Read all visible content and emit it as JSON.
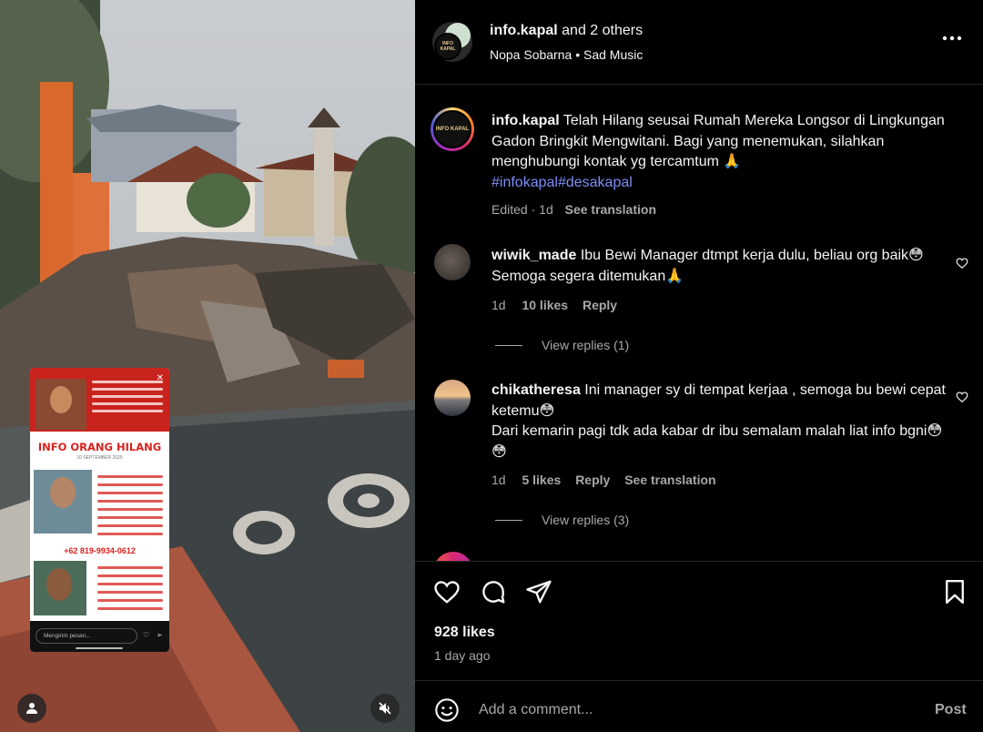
{
  "header": {
    "username": "info.kapal",
    "collab_text": "and 2 others",
    "sub_author": "Nopa Sobarna",
    "separator": "•",
    "sub_audio": "Sad Music",
    "avatar_text": "INFO KAPAL"
  },
  "caption": {
    "username": "info.kapal",
    "text": "Telah Hilang seusai Rumah Mereka Longsor di Lingkungan Gadon Bringkit Mengwitani. Bagi yang menemukan, silahkan menghubungi kontak yg tercamtum 🙏",
    "hashtags": "#infokapal#desakapal",
    "edited": "Edited",
    "dot": "·",
    "age": "1d",
    "see_translation": "See translation"
  },
  "comments": [
    {
      "username": "wiwik_made",
      "text": "Ibu Bewi Manager dtmpt kerja dulu, beliau org baik😳 Semoga segera ditemukan🙏",
      "age": "1d",
      "likes": "10 likes",
      "reply": "Reply",
      "view_replies": "View replies (1)"
    },
    {
      "username": "chikatheresa",
      "text": "Ini manager sy di tempat kerjaa , semoga bu bewi cepat ketemu😳",
      "text2": "Dari kemarin pagi tdk ada kabar dr ibu semalam malah liat info bgni😳 😳",
      "age": "1d",
      "likes": "5 likes",
      "reply": "Reply",
      "see_translation": "See translation",
      "view_replies": "View replies (3)"
    }
  ],
  "post": {
    "likes": "928 likes",
    "time": "1 day ago"
  },
  "add_comment": {
    "placeholder": "Add a comment...",
    "post_label": "Post"
  },
  "story": {
    "headline": "INFO ORANG HILANG",
    "date": "10 SEPTEMBER 2025",
    "phone": "+62 819-9934-0612",
    "message_placeholder": "Mengirim pesan..."
  },
  "colors": {
    "background": "#000000",
    "secondary_text": "#a8a8a8",
    "hashtag": "#7b8ef6",
    "story_red": "#d8231d"
  },
  "icons": [
    "heart-icon",
    "comment-icon",
    "share-icon",
    "bookmark-icon",
    "more-icon",
    "emoji-icon",
    "user-icon",
    "mute-icon"
  ]
}
